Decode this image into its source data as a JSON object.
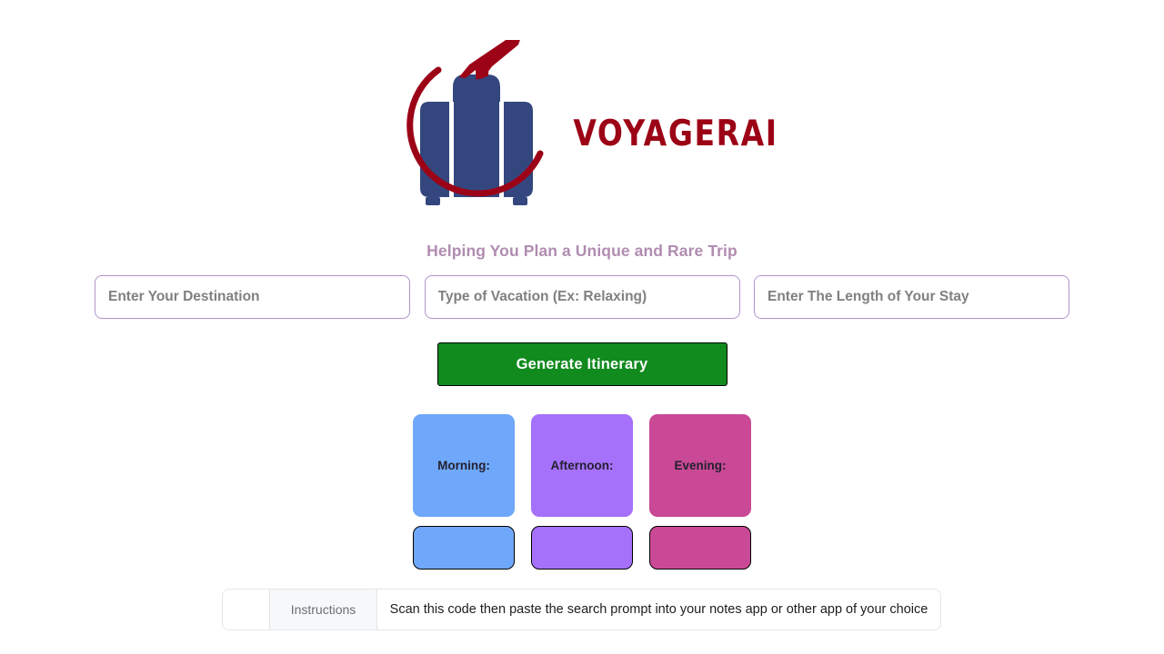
{
  "brand": {
    "name": "VOYAGERAI",
    "logo_icon": "suitcase-airplane-arc-logo",
    "wordmark_color": "#9C0316",
    "suitcase_color": "#33477E",
    "arc_color": "#9C0316"
  },
  "tagline": {
    "text": "Helping You Plan a Unique and Rare Trip",
    "color": "#B08CB0"
  },
  "form": {
    "fields": [
      {
        "name": "destination",
        "placeholder": "Enter Your Destination",
        "value": ""
      },
      {
        "name": "vacation-type",
        "placeholder": "Type of Vacation (Ex: Relaxing)",
        "value": ""
      },
      {
        "name": "length-of-stay",
        "placeholder": "Enter The Length of Your Stay",
        "value": ""
      }
    ],
    "border_color": "#B095CC",
    "submit": {
      "label": "Generate Itinerary",
      "background": "#118A1E",
      "text_color": "#FFFFFF"
    }
  },
  "itinerary": {
    "periods": [
      {
        "label": "Morning:",
        "color": "#6FA8FA",
        "content": "",
        "button_label": ""
      },
      {
        "label": "Afternoon:",
        "color": "#A571FB",
        "content": "",
        "button_label": ""
      },
      {
        "label": "Evening:",
        "color": "#C94996",
        "content": "",
        "button_label": ""
      }
    ]
  },
  "instructions_bar": {
    "blank_cell": "",
    "label": "Instructions",
    "text": "Scan this code then paste the search prompt into your notes app or other app of your choice"
  }
}
